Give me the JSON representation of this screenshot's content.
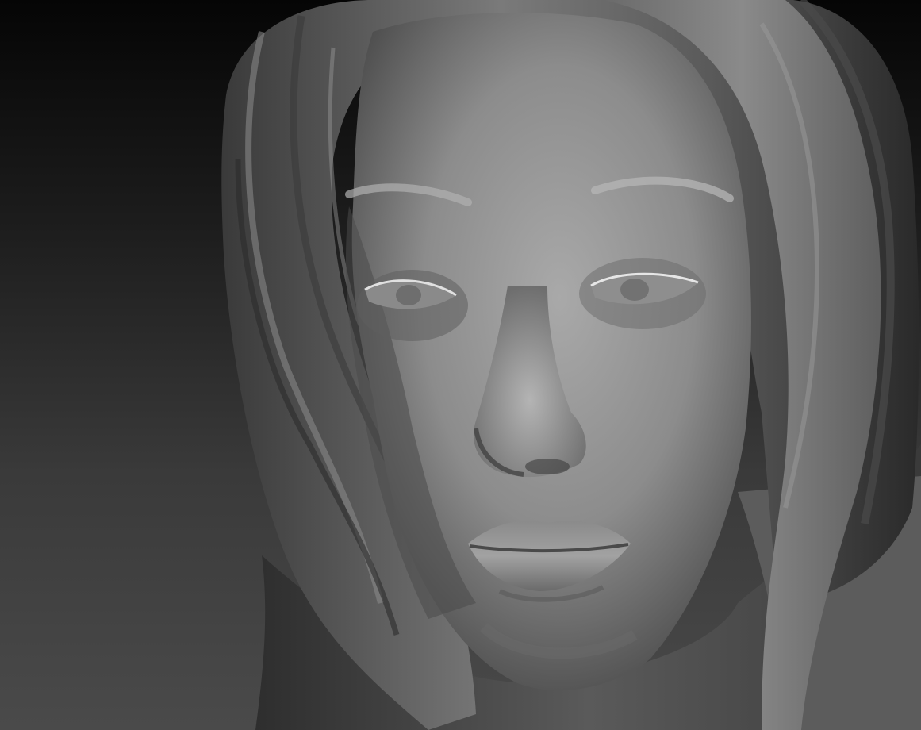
{
  "scene": {
    "subject": "sculpt-head-icon",
    "colors": {
      "background_top": "#050505",
      "background_bottom": "#4a4a4a",
      "clay_light": "#a6a6a6",
      "clay_mid": "#7a7a7a",
      "clay_dark": "#2c2c2c"
    }
  }
}
